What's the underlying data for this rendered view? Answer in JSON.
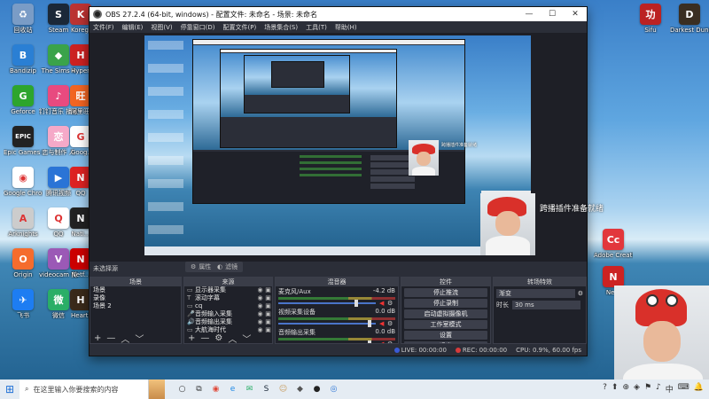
{
  "desktop": {
    "left_icons": [
      {
        "label": "回收站",
        "color": "#7a9cc6",
        "glyph": "♻"
      },
      {
        "label": "Steam",
        "color": "#1b2838",
        "glyph": "S"
      },
      {
        "label": "Korega...",
        "color": "#b33",
        "glyph": "K"
      },
      {
        "label": "Bandizip",
        "color": "#2a7fd4",
        "glyph": "B"
      },
      {
        "label": "The Sims 4",
        "color": "#3aa34a",
        "glyph": "◆"
      },
      {
        "label": "Hyper...",
        "color": "#c22",
        "glyph": "H"
      },
      {
        "label": "Geforce",
        "color": "#2da52d",
        "glyph": "G"
      },
      {
        "label": "钉钉音乐\n播放",
        "color": "#e84a7f",
        "glyph": "♪"
      },
      {
        "label": "阿里旺旺",
        "color": "#f26522",
        "glyph": "旺"
      },
      {
        "label": "Epic Games\nLauncher",
        "color": "#222",
        "glyph": "EPIC"
      },
      {
        "label": "恋与制作\n人",
        "color": "#f5a9c8",
        "glyph": "恋"
      },
      {
        "label": "Goog...",
        "color": "#fff",
        "glyph": "G"
      },
      {
        "label": "Google\nChrome",
        "color": "#fff",
        "glyph": "◉"
      },
      {
        "label": "腾讯视频",
        "color": "#2a74d6",
        "glyph": "▶"
      },
      {
        "label": "QQ",
        "color": "#d22",
        "glyph": "N"
      },
      {
        "label": "Arknights",
        "color": "#ccc",
        "glyph": "A"
      },
      {
        "label": "QQ",
        "color": "#fff",
        "glyph": "Q"
      },
      {
        "label": "Nati...",
        "color": "#222",
        "glyph": "N"
      },
      {
        "label": "Origin",
        "color": "#f56c2d",
        "glyph": "O"
      },
      {
        "label": "videocam\n剪辑",
        "color": "#9b59b6",
        "glyph": "V"
      },
      {
        "label": "Netf...",
        "color": "#c00",
        "glyph": "N"
      },
      {
        "label": "飞书",
        "color": "#1d7df2",
        "glyph": "✈"
      },
      {
        "label": "微信",
        "color": "#2aae67",
        "glyph": "微"
      },
      {
        "label": "Hearth...",
        "color": "#3a2a1a",
        "glyph": "H"
      }
    ],
    "right_icons": [
      {
        "label": "Sifu",
        "color": "#b22",
        "glyph": "功"
      },
      {
        "label": "Darkest\nDungeon II",
        "color": "#3a2e22",
        "glyph": "D"
      },
      {
        "label": "Adobe\nCreative...",
        "color": "#e2373c",
        "glyph": "Cc"
      },
      {
        "label": "Ne...",
        "color": "#c22",
        "glyph": "N"
      }
    ]
  },
  "obs": {
    "title": "OBS 27.2.4 (64-bit, windows) - 配置文件: 未命名 - 场景: 未命名",
    "window_buttons": [
      "—",
      "☐",
      "✕"
    ],
    "menu": [
      "文件(F)",
      "编辑(E)",
      "视图(V)",
      "停靠窗口(D)",
      "配置文件(P)",
      "场景集合(S)",
      "工具(T)",
      "帮助(H)"
    ],
    "overlay_text": "跨播插件准备就绪",
    "scene_label": "未选择源",
    "mini_toolbar": [
      {
        "icon": "⚙",
        "label": "属性"
      },
      {
        "icon": "◐",
        "label": "滤镜"
      }
    ],
    "docks": {
      "scenes": {
        "title": "场景",
        "items": [
          "场景",
          "录像",
          "场景 2"
        ]
      },
      "sources": {
        "title": "来源",
        "items": [
          {
            "icon": "▭",
            "name": "显示器采集"
          },
          {
            "icon": "T",
            "name": "滚动字幕"
          },
          {
            "icon": "▭",
            "name": "cq"
          },
          {
            "icon": "🎤",
            "name": "音频输入采集"
          },
          {
            "icon": "🔊",
            "name": "音频输出采集"
          },
          {
            "icon": "▭",
            "name": "大航海时代"
          }
        ]
      },
      "mixer": {
        "title": "混音器",
        "items": [
          {
            "name": "麦克风/Aux",
            "db": "-4.2 dB",
            "level": 0.78
          },
          {
            "name": "视频采集设备",
            "db": "0.0 dB",
            "level": 0.92
          },
          {
            "name": "音频输出采集",
            "db": "0.0 dB",
            "level": 0.92
          }
        ]
      },
      "controls": {
        "title": "控件",
        "buttons": [
          "停止推流",
          "停止录制",
          "启动虚拟摄像机",
          "工作室模式",
          "设置",
          "退出"
        ]
      },
      "transitions": {
        "title": "转场特效",
        "type": "渐变",
        "duration_label": "时长",
        "duration": "30 ms"
      }
    },
    "status": {
      "dropped": "",
      "live": "LIVE: 00:00:00",
      "rec": "REC: 00:00:00",
      "cpu": "CPU: 0.9%, 60.00 fps"
    }
  },
  "taskbar": {
    "search_placeholder": "在这里输入你要搜索的内容",
    "apps": [
      {
        "glyph": "○",
        "color": "#333"
      },
      {
        "glyph": "⧉",
        "color": "#333"
      },
      {
        "glyph": "◉",
        "color": "#e04a3a"
      },
      {
        "glyph": "e",
        "color": "#1e88e5"
      },
      {
        "glyph": "✉",
        "color": "#2aae67"
      },
      {
        "glyph": "S",
        "color": "#1b2838"
      },
      {
        "glyph": "☺",
        "color": "#c79b5c"
      },
      {
        "glyph": "◆",
        "color": "#555"
      },
      {
        "glyph": "●",
        "color": "#222"
      },
      {
        "glyph": "◎",
        "color": "#2a74d6"
      }
    ],
    "tray": [
      "?",
      "⬆",
      "⊕",
      "◈",
      "⚑",
      "♪",
      "中",
      "⌨",
      "🔔"
    ]
  }
}
